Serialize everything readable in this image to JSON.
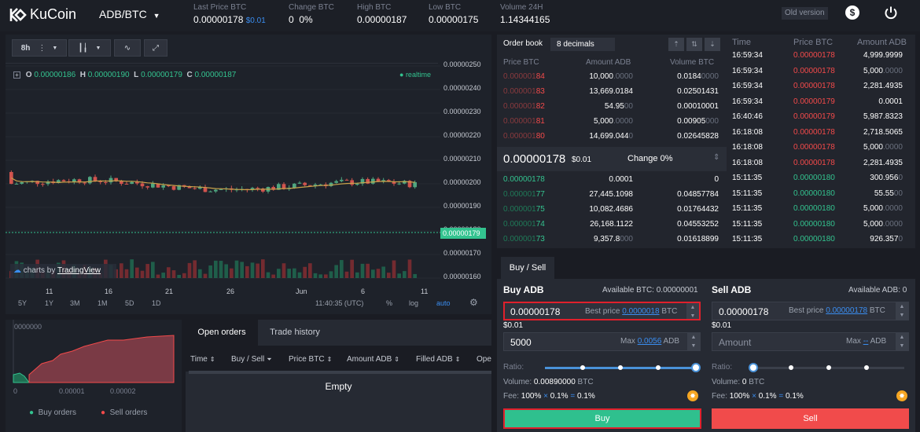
{
  "brand": {
    "name": "KuCoin"
  },
  "pair": {
    "label": "ADB/BTC"
  },
  "ticker": {
    "last_price_label": "Last Price BTC",
    "last_price": "0.00000178",
    "last_price_usd": "$0.01",
    "change_label": "Change BTC",
    "change": "0",
    "change_pct": "0%",
    "high_label": "High BTC",
    "high": "0.00000187",
    "low_label": "Low BTC",
    "low": "0.00000175",
    "volume_label": "Volume 24H",
    "volume": "1.14344165"
  },
  "header": {
    "old_version": "Old version"
  },
  "chart": {
    "interval": "8h",
    "ohlc": {
      "o_label": "O",
      "o": "0.00000186",
      "h_label": "H",
      "h": "0.00000190",
      "l_label": "L",
      "l": "0.00000179",
      "c_label": "C",
      "c": "0.00000187"
    },
    "realtime": "realtime",
    "credit_prefix": "charts by",
    "credit_link": "TradingView",
    "ranges": [
      "5Y",
      "1Y",
      "3M",
      "1M",
      "5D",
      "1D"
    ],
    "time": "11:40:35 (UTC)",
    "opts": {
      "pct": "%",
      "log": "log",
      "auto": "auto"
    }
  },
  "chart_data": {
    "type": "candlestick",
    "x_ticks": [
      "11",
      "16",
      "21",
      "26",
      "Jun",
      "6",
      "11"
    ],
    "y_ticks": [
      "0.00000250",
      "0.00000240",
      "0.00000230",
      "0.00000220",
      "0.00000210",
      "0.00000200",
      "0.00000190",
      "0.00000180",
      "0.00000170",
      "0.00000160"
    ],
    "current_price_label": "0.00000179",
    "ylim": [
      1.6e-06,
      2.5e-06
    ]
  },
  "depth": {
    "y_label": "0000000",
    "x_ticks": [
      "0",
      "0.00001",
      "0.00002"
    ],
    "legend_buy": "Buy orders",
    "legend_sell": "Sell orders"
  },
  "orders": {
    "tabs": [
      "Open orders",
      "Trade history"
    ],
    "columns": [
      "Time",
      "Buy / Sell",
      "Price BTC",
      "Amount ADB",
      "Filled ADB",
      "Ope"
    ],
    "empty": "Empty"
  },
  "orderbook": {
    "title": "Order book",
    "decimals": "8 decimals",
    "columns": [
      "Price BTC",
      "Amount ADB",
      "Volume BTC"
    ],
    "asks": [
      {
        "price_dim": "0.000001",
        "price_hi": "84",
        "amount": "10,000",
        "amount_dim": ".0000",
        "volume": "0.0184",
        "volume_dim": "0000"
      },
      {
        "price_dim": "0.000001",
        "price_hi": "83",
        "amount": "13,669.0184",
        "amount_dim": "",
        "volume": "0.02501431",
        "volume_dim": ""
      },
      {
        "price_dim": "0.000001",
        "price_hi": "82",
        "amount": "54.95",
        "amount_dim": "00",
        "volume": "0.00010001",
        "volume_dim": ""
      },
      {
        "price_dim": "0.000001",
        "price_hi": "81",
        "amount": "5,000",
        "amount_dim": ".0000",
        "volume": "0.00905",
        "volume_dim": "000"
      },
      {
        "price_dim": "0.000001",
        "price_hi": "80",
        "amount": "14,699.044",
        "amount_dim": "0",
        "volume": "0.02645828",
        "volume_dim": ""
      }
    ],
    "mid_price": "0.00000178",
    "mid_usd": "$0.01",
    "mid_change": "Change 0%",
    "bids": [
      {
        "price_dim": "",
        "price_hi": "0.00000178",
        "amount": "0.0001",
        "amount_dim": "",
        "volume": "0",
        "volume_dim": ""
      },
      {
        "price_dim": "0.000001",
        "price_hi": "77",
        "amount": "27,445.1098",
        "amount_dim": "",
        "volume": "0.04857784",
        "volume_dim": ""
      },
      {
        "price_dim": "0.000001",
        "price_hi": "75",
        "amount": "10,082.4686",
        "amount_dim": "",
        "volume": "0.01764432",
        "volume_dim": ""
      },
      {
        "price_dim": "0.000001",
        "price_hi": "74",
        "amount": "26,168.1122",
        "amount_dim": "",
        "volume": "0.04553252",
        "volume_dim": ""
      },
      {
        "price_dim": "0.000001",
        "price_hi": "73",
        "amount": "9,357.8",
        "amount_dim": "000",
        "volume": "0.01618899",
        "volume_dim": ""
      }
    ]
  },
  "trades": {
    "columns": [
      "Time",
      "Price BTC",
      "Amount ADB"
    ],
    "rows": [
      {
        "time": "16:59:34",
        "price": "0.00000178",
        "side": "sell",
        "amount": "4,999.9999",
        "amount_dim": ""
      },
      {
        "time": "16:59:34",
        "price": "0.00000178",
        "side": "sell",
        "amount": "5,000",
        "amount_dim": ".0000"
      },
      {
        "time": "16:59:34",
        "price": "0.00000178",
        "side": "sell",
        "amount": "2,281.4935",
        "amount_dim": ""
      },
      {
        "time": "16:59:34",
        "price": "0.00000179",
        "side": "sell",
        "amount": "0.0001",
        "amount_dim": ""
      },
      {
        "time": "16:40:46",
        "price": "0.00000179",
        "side": "sell",
        "amount": "5,987.8323",
        "amount_dim": ""
      },
      {
        "time": "16:18:08",
        "price": "0.00000178",
        "side": "sell",
        "amount": "2,718.5065",
        "amount_dim": ""
      },
      {
        "time": "16:18:08",
        "price": "0.00000178",
        "side": "sell",
        "amount": "5,000",
        "amount_dim": ".0000"
      },
      {
        "time": "16:18:08",
        "price": "0.00000178",
        "side": "sell",
        "amount": "2,281.4935",
        "amount_dim": ""
      },
      {
        "time": "15:11:35",
        "price": "0.00000180",
        "side": "buy",
        "amount": "300.956",
        "amount_dim": "0"
      },
      {
        "time": "15:11:35",
        "price": "0.00000180",
        "side": "buy",
        "amount": "55.55",
        "amount_dim": "00"
      },
      {
        "time": "15:11:35",
        "price": "0.00000180",
        "side": "buy",
        "amount": "5,000",
        "amount_dim": ".0000"
      },
      {
        "time": "15:11:35",
        "price": "0.00000180",
        "side": "buy",
        "amount": "5,000",
        "amount_dim": ".0000"
      },
      {
        "time": "15:11:35",
        "price": "0.00000180",
        "side": "buy",
        "amount": "926.357",
        "amount_dim": "0"
      }
    ]
  },
  "trade_form": {
    "tab": "Buy / Sell",
    "buy": {
      "title": "Buy ADB",
      "available": "Available BTC: 0.00000001",
      "price": "0.00000178",
      "best_price_label": "Best price",
      "best_price": "0.0000018",
      "best_unit": "BTC",
      "usd": "$0.01",
      "amount": "5000",
      "max_label": "Max",
      "max_val": "0.0056",
      "max_unit": "ADB",
      "ratio_label": "Ratio:",
      "ratio": 1.0,
      "volume_label": "Volume:",
      "volume": "0.00890000",
      "volume_unit": "BTC",
      "fee_label": "Fee:",
      "fee_a": "100%",
      "fee_x": "×",
      "fee_b": "0.1%",
      "fee_eq": "=",
      "fee_c": "0.1%",
      "button": "Buy"
    },
    "sell": {
      "title": "Sell ADB",
      "available": "Available ADB: 0",
      "price": "0.00000178",
      "best_price_label": "Best price",
      "best_price": "0.00000178",
      "best_unit": "BTC",
      "usd": "$0.01",
      "amount_placeholder": "Amount",
      "max_label": "Max",
      "max_val": "--",
      "max_unit": "ADB",
      "ratio_label": "Ratio:",
      "ratio": 0.0,
      "volume_label": "Volume:",
      "volume": "0",
      "volume_unit": "BTC",
      "fee_label": "Fee:",
      "fee_a": "100%",
      "fee_x": "×",
      "fee_b": "0.1%",
      "fee_eq": "=",
      "fee_c": "0.1%",
      "button": "Sell"
    }
  },
  "colors": {
    "green": "#33c38f",
    "red": "#f44a4a",
    "accent": "#3a8df0",
    "buy_button": "#2fc08e",
    "sell_button": "#f14b4b",
    "highlight_border": "#e0202c"
  }
}
